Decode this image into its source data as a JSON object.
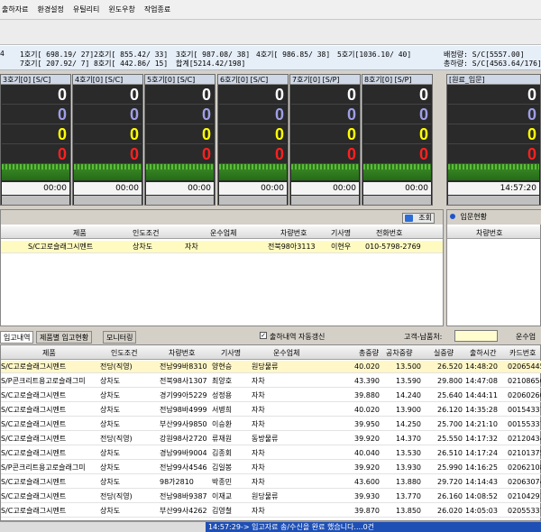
{
  "menu": [
    "출하자료",
    "환경설정",
    "유틸리티",
    "윈도우창",
    "작업종료"
  ],
  "summary": {
    "lane1": "1호기[ 698.19/ 27]",
    "lane2": "2호기[ 855.42/ 33]",
    "lane3": "3호기[ 987.08/ 38]",
    "lane4": "4호기[ 986.85/ 38]",
    "lane5": "5호기[1036.10/ 40]",
    "lane7": "7호기[ 207.92/ 7]",
    "lane8": "8호기[ 442.86/ 15]",
    "total": "합계[5214.42/198]",
    "left_cut": "4",
    "stock": "배정량: S/C[5557.00]",
    "sum": "총하량: S/C[4563.64/176]"
  },
  "bays": [
    {
      "title": "3호기[0] [S/C]",
      "v1": "0",
      "v2": "0",
      "v3": "0",
      "v4": "0",
      "time": "00:00"
    },
    {
      "title": "4호기[0] [S/C]",
      "v1": "0",
      "v2": "0",
      "v3": "0",
      "v4": "0",
      "time": "00:00"
    },
    {
      "title": "5호기[0] [S/C]",
      "v1": "0",
      "v2": "0",
      "v3": "0",
      "v4": "0",
      "time": "00:00"
    },
    {
      "title": "6호기[0] [S/C]",
      "v1": "0",
      "v2": "0",
      "v3": "0",
      "v4": "0",
      "time": "00:00"
    },
    {
      "title": "7호기[0] [S/P]",
      "v1": "0",
      "v2": "0",
      "v3": "0",
      "v4": "0",
      "time": "00:00"
    },
    {
      "title": "8호기[0] [S/P]",
      "v1": "0",
      "v2": "0",
      "v3": "0",
      "v4": "0",
      "time": "00:00"
    },
    {
      "title": "[원료_입문]",
      "v1": "0",
      "v2": "0",
      "v3": "0",
      "v4": "0",
      "time": "14:57:20"
    }
  ],
  "pending": {
    "search_label": "조회",
    "headers": [
      "제품",
      "인도조건",
      "운수업체",
      "차량번호",
      "기사명",
      "전화번호"
    ],
    "row": [
      "S/C고로슬래그시멘트",
      "상차도",
      "자차",
      "전북98아3113",
      "이현우",
      "010-5798-2769"
    ],
    "inbound_title": "입문현황",
    "inbound_header": "차량번호"
  },
  "tabs": [
    "입고내역",
    "제품별 입고현황",
    "모니터링"
  ],
  "auto_refresh": "출하내역 자동갱신",
  "customer_label": "고객-납품처:",
  "transport_label": "운수업",
  "grid": {
    "headers": [
      "제품",
      "인도조건",
      "차량번호",
      "기사명",
      "운수업체",
      "총중량",
      "공차중량",
      "실중량",
      "출하시간",
      "카드번호"
    ],
    "rows": [
      [
        "S/C고로슬래그시멘트",
        "전당(직영)",
        "전남99바8310",
        "양현승",
        "원당물류",
        "40.020",
        "13.500",
        "26.520",
        "14:48:20",
        "02065445"
      ],
      [
        "S/P콘크리트용고로슬래그미",
        "상차도",
        "전북98사1307",
        "최양호",
        "자차",
        "43.390",
        "13.590",
        "29.800",
        "14:47:08",
        "02108656"
      ],
      [
        "S/C고로슬래그시멘트",
        "상차도",
        "경기99아5229",
        "성정용",
        "자차",
        "39.880",
        "14.240",
        "25.640",
        "14:44:11",
        "02060260"
      ],
      [
        "S/C고로슬래그시멘트",
        "상차도",
        "전남98바4999",
        "서병희",
        "자차",
        "40.020",
        "13.900",
        "26.120",
        "14:35:28",
        "00154337"
      ],
      [
        "S/C고로슬래그시멘트",
        "상차도",
        "부산99사9850",
        "이승환",
        "자차",
        "39.950",
        "14.250",
        "25.700",
        "14:21:10",
        "00155337"
      ],
      [
        "S/C고로슬래그시멘트",
        "전당(직영)",
        "강원98사2720",
        "류재원",
        "동방물류",
        "39.920",
        "14.370",
        "25.550",
        "14:17:32",
        "02120434"
      ],
      [
        "S/C고로슬래그시멘트",
        "상차도",
        "경남99바9004",
        "김종회",
        "자차",
        "40.040",
        "13.530",
        "26.510",
        "14:17:24",
        "02101375"
      ],
      [
        "S/P콘크리트용고로슬래그미",
        "상차도",
        "전남99사4546",
        "김일봉",
        "자차",
        "39.920",
        "13.930",
        "25.990",
        "14:16:25",
        "02062108"
      ],
      [
        "S/C고로슬래그시멘트",
        "상차도",
        "98가2810",
        "박종민",
        "자차",
        "43.600",
        "13.880",
        "29.720",
        "14:14:43",
        "02063074"
      ],
      [
        "S/C고로슬래그시멘트",
        "전당(직영)",
        "전남98바9387",
        "이재교",
        "원당물류",
        "39.930",
        "13.770",
        "26.160",
        "14:08:52",
        "02104291"
      ],
      [
        "S/C고로슬래그시멘트",
        "상차도",
        "부산99사4262",
        "김영철",
        "자차",
        "39.870",
        "13.850",
        "26.020",
        "14:05:03",
        "02055337"
      ]
    ]
  },
  "status": {
    "message": "14:57:29-> 입고자료 송/수신을 완료 했습니다....0건"
  }
}
